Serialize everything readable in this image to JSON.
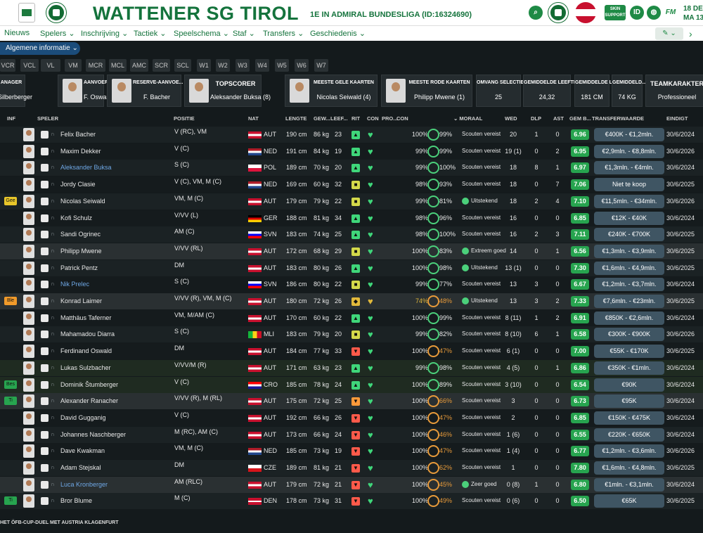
{
  "header": {
    "title": "WATTENER SG TIROL",
    "subtitle": "1E IN ADMIRAL BUNDESLIGA (ID:16324690)",
    "skin_label": "SKIN SUPPORT",
    "id_icon": "ID",
    "fm_icon": "FM",
    "date_line1": "18 DEC",
    "date_line2": "MA 13"
  },
  "nav": {
    "items": [
      "Nieuws",
      "Spelers ⌄",
      "Inschrijving ⌄",
      "Tactiek ⌄",
      "Speelschema ⌄",
      "Staf ⌄",
      "Transfers ⌄",
      "Geschiedenis ⌄"
    ],
    "edit_button": "✎ ⌄"
  },
  "pill": "Algemene informatie ⌄",
  "tabs": [
    "VCR",
    "VCL",
    "VL",
    "VM",
    "MCR",
    "MCL",
    "AMC",
    "SCR",
    "SCL",
    "W1",
    "W2",
    "W3",
    "W4",
    "W5",
    "W6",
    "W7"
  ],
  "cards": [
    {
      "title": "ANAGER",
      "value": "Silberberger"
    },
    {
      "title": "AANVOERDER",
      "value": "F. Oswald"
    },
    {
      "title": "RESERVE-AANVOE...",
      "value": "F. Bacher"
    },
    {
      "title": "TOPSCORER",
      "value": "Aleksander Buksa (8)"
    },
    {
      "title": "MEESTE GELE KAARTEN",
      "value": "Nicolas Seiwald (4)"
    },
    {
      "title": "MEESTE RODE KAARTEN",
      "value": "Philipp Mwene (1)"
    },
    {
      "title": "OMVANG SELECTIE",
      "value": "25"
    },
    {
      "title": "GEMIDDELDE LEEFTI...",
      "value": "24,32"
    },
    {
      "title": "GEMIDDELDE LE...",
      "value": "181 CM"
    },
    {
      "title": "GEMIDDELD...",
      "value": "74 KG"
    },
    {
      "title": "TEAMKARAKTER",
      "value": "Professioneel"
    }
  ],
  "columns": {
    "inf": "INF",
    "speler": "SPELER",
    "positie": "POSITIE",
    "nat": "NAT",
    "lengte": "LENGTE",
    "gew": "GEW...",
    "leef": "LEEF...",
    "rit": "RIT",
    "con": "CON",
    "pro": "PRO...",
    "con2": "CON",
    "moraal": "⌄ MORAAL",
    "wed": "WED",
    "dlp": "DLP",
    "ast": "AST",
    "gemb": "GEM B...",
    "transfer": "TRANSFERWAARDE",
    "eind": "EINDIGT"
  },
  "colors": {
    "green": "#27a44f",
    "dark_green": "#14733c",
    "row_bg": "#1b2224",
    "accent_blue": "#1b4c7a"
  },
  "players": [
    {
      "inf": "",
      "name": "Felix Bacher",
      "pos": "V (RC), VM",
      "nat": "AUT",
      "len": "190 cm",
      "wt": "86 kg",
      "age": "23",
      "rit": "up",
      "pct": "100%",
      "pct2": "99%",
      "moraal": "Scouten vereist",
      "wed": "20",
      "dlp": "1",
      "ast": "0",
      "gem": "6.96",
      "tw": "€400K - €1,2mln.",
      "eind": "30/6/2024"
    },
    {
      "inf": "",
      "name": "Maxim Dekker",
      "pos": "V (C)",
      "nat": "NED",
      "len": "191 cm",
      "wt": "84 kg",
      "age": "19",
      "rit": "up",
      "pct": "99%",
      "pct2": "99%",
      "moraal": "Scouten vereist",
      "wed": "19 (1)",
      "dlp": "0",
      "ast": "2",
      "gem": "6.95",
      "tw": "€2,9mln. - €8,8mln.",
      "eind": "30/6/2026"
    },
    {
      "inf": "",
      "name": "Aleksander Buksa",
      "pos": "S (C)",
      "nat": "POL",
      "len": "189 cm",
      "wt": "70 kg",
      "age": "20",
      "rit": "up",
      "pct": "99%",
      "pct2": "100%",
      "moraal": "Scouten vereist",
      "wed": "18",
      "dlp": "8",
      "ast": "1",
      "gem": "6.97",
      "tw": "€1,3mln. - €4mln.",
      "eind": "30/6/2024"
    },
    {
      "inf": "",
      "name": "Jordy Clasie",
      "pos": "V (C), VM, M (C)",
      "nat": "NED",
      "len": "169 cm",
      "wt": "60 kg",
      "age": "32",
      "rit": "mid",
      "pct": "98%",
      "pct2": "93%",
      "moraal": "Scouten vereist",
      "wed": "18",
      "dlp": "0",
      "ast": "7",
      "gem": "7.06",
      "tw": "Niet te koop",
      "eind": "30/6/2025"
    },
    {
      "inf": "Gee",
      "name": "Nicolas Seiwald",
      "pos": "VM, M (C)",
      "nat": "AUT",
      "len": "179 cm",
      "wt": "79 kg",
      "age": "22",
      "rit": "mid",
      "pct": "99%",
      "pct2": "81%",
      "moraal": "Uitstekend",
      "wed": "18",
      "dlp": "2",
      "ast": "4",
      "gem": "7.10",
      "tw": "€11,5mln. - €34mln.",
      "eind": "30/6/2026"
    },
    {
      "inf": "",
      "name": "Kofi Schulz",
      "pos": "V/VV (L)",
      "nat": "GER",
      "len": "188 cm",
      "wt": "81 kg",
      "age": "34",
      "rit": "up",
      "pct": "98%",
      "pct2": "96%",
      "moraal": "Scouten vereist",
      "wed": "16",
      "dlp": "0",
      "ast": "0",
      "gem": "6.85",
      "tw": "€12K - €40K",
      "eind": "30/6/2024"
    },
    {
      "inf": "",
      "name": "Sandi Ogrinec",
      "pos": "AM (C)",
      "nat": "SVN",
      "len": "183 cm",
      "wt": "74 kg",
      "age": "25",
      "rit": "up",
      "pct": "98%",
      "pct2": "100%",
      "moraal": "Scouten vereist",
      "wed": "16",
      "dlp": "2",
      "ast": "3",
      "gem": "7.11",
      "tw": "€240K - €700K",
      "eind": "30/6/2025"
    },
    {
      "inf": "",
      "name": "Philipp Mwene",
      "pos": "V/VV (RL)",
      "nat": "AUT",
      "len": "172 cm",
      "wt": "68 kg",
      "age": "29",
      "rit": "mid",
      "pct": "100%",
      "pct2": "83%",
      "moraal": "Extreem goed",
      "wed": "14",
      "dlp": "0",
      "ast": "1",
      "gem": "6.56",
      "tw": "€1,3mln. - €3,9mln.",
      "eind": "30/6/2025"
    },
    {
      "inf": "",
      "name": "Patrick Pentz",
      "pos": "DM",
      "nat": "AUT",
      "len": "183 cm",
      "wt": "80 kg",
      "age": "26",
      "rit": "up",
      "pct": "100%",
      "pct2": "98%",
      "moraal": "Uitstekend",
      "wed": "13 (1)",
      "dlp": "0",
      "ast": "0",
      "gem": "7.30",
      "tw": "€1,6mln. - €4,9mln.",
      "eind": "30/6/2025"
    },
    {
      "inf": "",
      "name": "Nik Prelec",
      "pos": "S (C)",
      "nat": "SVN",
      "len": "186 cm",
      "wt": "80 kg",
      "age": "22",
      "rit": "mid",
      "pct": "99%",
      "pct2": "77%",
      "moraal": "Scouten vereist",
      "wed": "13",
      "dlp": "3",
      "ast": "0",
      "gem": "6.67",
      "tw": "€1,2mln. - €3,7mln.",
      "eind": "30/6/2024"
    },
    {
      "inf": "Ble",
      "name": "Konrad Laimer",
      "pos": "V/VV (R), VM, M (C)",
      "nat": "AUT",
      "len": "180 cm",
      "wt": "72 kg",
      "age": "26",
      "rit": "shield",
      "pct": "74%",
      "pct2": "48%",
      "moraal": "Uitstekend",
      "wed": "13",
      "dlp": "3",
      "ast": "2",
      "gem": "7.33",
      "tw": "€7,6mln. - €23mln.",
      "eind": "30/6/2025"
    },
    {
      "inf": "",
      "name": "Matthäus Taferner",
      "pos": "VM, M/AM (C)",
      "nat": "AUT",
      "len": "170 cm",
      "wt": "60 kg",
      "age": "22",
      "rit": "up",
      "pct": "100%",
      "pct2": "99%",
      "moraal": "Scouten vereist",
      "wed": "8 (11)",
      "dlp": "1",
      "ast": "2",
      "gem": "6.91",
      "tw": "€850K - €2,6mln.",
      "eind": "30/6/2024"
    },
    {
      "inf": "",
      "name": "Mahamadou Diarra",
      "pos": "S (C)",
      "nat": "MLI",
      "len": "183 cm",
      "wt": "79 kg",
      "age": "20",
      "rit": "mid",
      "pct": "99%",
      "pct2": "82%",
      "moraal": "Scouten vereist",
      "wed": "8 (10)",
      "dlp": "6",
      "ast": "1",
      "gem": "6.58",
      "tw": "€300K - €900K",
      "eind": "30/6/2026"
    },
    {
      "inf": "",
      "name": "Ferdinand Oswald",
      "pos": "DM",
      "nat": "AUT",
      "len": "184 cm",
      "wt": "77 kg",
      "age": "33",
      "rit": "down",
      "pct": "100%",
      "pct2": "47%",
      "moraal": "Scouten vereist",
      "wed": "6 (1)",
      "dlp": "0",
      "ast": "0",
      "gem": "7.00",
      "tw": "€55K - €170K",
      "eind": "30/6/2025"
    },
    {
      "inf": "",
      "name": "Lukas Sulzbacher",
      "pos": "V/VV/M (R)",
      "nat": "AUT",
      "len": "171 cm",
      "wt": "63 kg",
      "age": "23",
      "rit": "up",
      "pct": "99%",
      "pct2": "98%",
      "moraal": "Scouten vereist",
      "wed": "4 (5)",
      "dlp": "0",
      "ast": "1",
      "gem": "6.86",
      "tw": "€350K - €1mln.",
      "eind": "30/6/2024"
    },
    {
      "inf": "Bes",
      "name": "Dominik Štumberger",
      "pos": "V (C)",
      "nat": "CRO",
      "len": "185 cm",
      "wt": "78 kg",
      "age": "24",
      "rit": "up",
      "pct": "100%",
      "pct2": "89%",
      "moraal": "Scouten vereist",
      "wed": "3 (10)",
      "dlp": "0",
      "ast": "0",
      "gem": "6.54",
      "tw": "€90K",
      "eind": "30/6/2024"
    },
    {
      "inf": "Ti",
      "name": "Alexander Ranacher",
      "pos": "V/VV (R), M (RL)",
      "nat": "AUT",
      "len": "175 cm",
      "wt": "72 kg",
      "age": "25",
      "rit": "warn",
      "pct": "100%",
      "pct2": "66%",
      "moraal": "Scouten vereist",
      "wed": "3",
      "dlp": "0",
      "ast": "0",
      "gem": "6.73",
      "tw": "€95K",
      "eind": "30/6/2024"
    },
    {
      "inf": "",
      "name": "David Gugganig",
      "pos": "V (C)",
      "nat": "AUT",
      "len": "192 cm",
      "wt": "66 kg",
      "age": "26",
      "rit": "down",
      "pct": "100%",
      "pct2": "47%",
      "moraal": "Scouten vereist",
      "wed": "2",
      "dlp": "0",
      "ast": "0",
      "gem": "6.85",
      "tw": "€150K - €475K",
      "eind": "30/6/2024"
    },
    {
      "inf": "",
      "name": "Johannes Naschberger",
      "pos": "M (RC), AM (C)",
      "nat": "AUT",
      "len": "173 cm",
      "wt": "66 kg",
      "age": "24",
      "rit": "down",
      "pct": "100%",
      "pct2": "46%",
      "moraal": "Scouten vereist",
      "wed": "1 (6)",
      "dlp": "0",
      "ast": "0",
      "gem": "6.55",
      "tw": "€220K - €650K",
      "eind": "30/6/2024"
    },
    {
      "inf": "",
      "name": "Dave Kwakman",
      "pos": "VM, M (C)",
      "nat": "NED",
      "len": "185 cm",
      "wt": "73 kg",
      "age": "19",
      "rit": "down",
      "pct": "100%",
      "pct2": "47%",
      "moraal": "Scouten vereist",
      "wed": "1 (4)",
      "dlp": "0",
      "ast": "0",
      "gem": "6.77",
      "tw": "€1,2mln. - €3,6mln.",
      "eind": "30/6/2026"
    },
    {
      "inf": "",
      "name": "Adam Stejskal",
      "pos": "DM",
      "nat": "CZE",
      "len": "189 cm",
      "wt": "81 kg",
      "age": "21",
      "rit": "down",
      "pct": "100%",
      "pct2": "62%",
      "moraal": "Scouten vereist",
      "wed": "1",
      "dlp": "0",
      "ast": "0",
      "gem": "7.80",
      "tw": "€1,6mln. - €4,8mln.",
      "eind": "30/6/2025"
    },
    {
      "inf": "",
      "name": "Luca Kronberger",
      "pos": "AM (RLC)",
      "nat": "AUT",
      "len": "179 cm",
      "wt": "72 kg",
      "age": "21",
      "rit": "down",
      "pct": "100%",
      "pct2": "45%",
      "moraal": "Zeer goed",
      "wed": "0 (8)",
      "dlp": "1",
      "ast": "0",
      "gem": "6.80",
      "tw": "€1mln. - €3,1mln.",
      "eind": "30/6/2024"
    },
    {
      "inf": "Ti",
      "name": "Bror Blume",
      "pos": "M (C)",
      "nat": "DEN",
      "len": "178 cm",
      "wt": "73 kg",
      "age": "31",
      "rit": "down",
      "pct": "100%",
      "pct2": "49%",
      "moraal": "Scouten vereist",
      "wed": "0 (6)",
      "dlp": "0",
      "ast": "0",
      "gem": "6.50",
      "tw": "€65K",
      "eind": "30/6/2025"
    }
  ],
  "footer": "HET ÖFB-CUP-DUEL MET AUSTRIA KLAGENFURT"
}
